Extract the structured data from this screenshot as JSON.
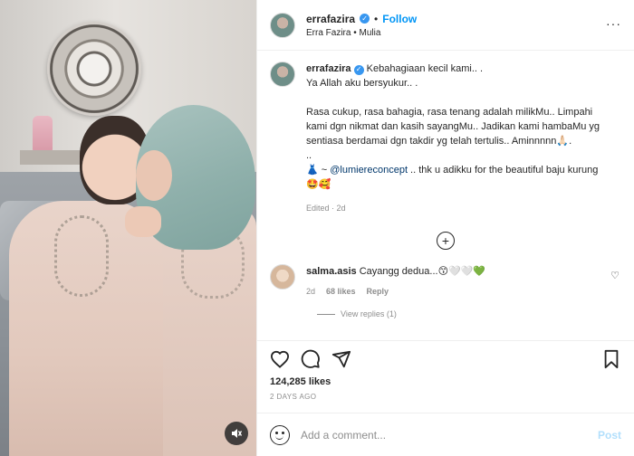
{
  "header": {
    "username": "errafazira",
    "follow_label": "Follow",
    "dot": "•",
    "subtitle": "Erra Fazira • Mulia",
    "more_label": "···"
  },
  "caption": {
    "username": "errafazira",
    "lines": [
      "Kebahagiaan kecil kami.. .",
      "Ya Allah aku bersyukur.. ."
    ],
    "paragraph": "Rasa cukup, rasa bahagia, rasa tenang adalah milikMu.. Limpahi kami dgn nikmat dan kasih sayangMu.. Jadikan kami hambaMu yg sentiasa berdamai dgn takdir yg telah tertulis.. Aminnnnn🙏🏻.",
    "dotdot": "..",
    "dress_line_prefix": "👗 ~ ",
    "mention": "@lumiereconcept",
    "dress_line_suffix": " .. thk u adikku for the beautiful baju kurung",
    "emoji_line": "🤩🥰",
    "meta": "Edited · 2d"
  },
  "comment": {
    "username": "salma.asis",
    "text": "Cayangg dedua...😙🤍🤍💚",
    "time": "2d",
    "likes": "68 likes",
    "reply": "Reply",
    "view_replies": "View replies (1)"
  },
  "stats": {
    "likes": "124,285 likes",
    "time": "2 DAYS AGO"
  },
  "add_comment": {
    "placeholder": "Add a comment...",
    "post_label": "Post"
  },
  "colors": {
    "accent": "#0095f6",
    "verified": "#3897f0",
    "post_disabled": "#b2dffc",
    "muted": "#8e8e8e"
  },
  "icons": {
    "like": "heart-icon",
    "comment": "comment-icon",
    "share": "share-icon",
    "save": "bookmark-icon",
    "emoji": "emoji-icon",
    "mute": "audio-muted-icon",
    "add": "plus-circle-icon"
  }
}
